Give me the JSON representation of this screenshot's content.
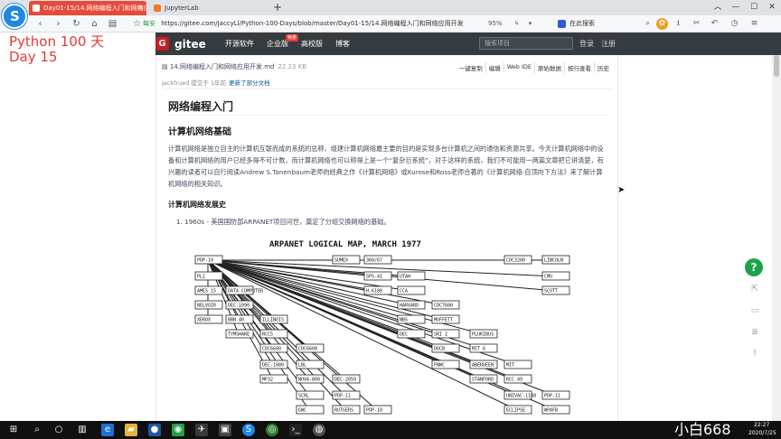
{
  "tabs": [
    {
      "title": "Day01-15/14.网络编程入门和网络应...",
      "active": true
    },
    {
      "title": "JupyterLab",
      "active": false
    }
  ],
  "new_tab": "+",
  "window_buttons": [
    "︿",
    "—",
    "☐",
    "✕"
  ],
  "address": {
    "safe_label": "每安",
    "url": "https://gitee.com/JaccyLl/Python-100-Days/blob/master/Day01-15/14.网络编程入门和网络应用开发",
    "zoom": "95%",
    "search_engine": "在此搜索"
  },
  "overlay": {
    "logo_glyph": "S",
    "title_line1": "Python 100 天",
    "title_line2": "Day 15"
  },
  "gitee": {
    "logo_letter": "G",
    "logo_text": "gitee",
    "nav": [
      "开源软件",
      "企业版",
      "高校版",
      "博客"
    ],
    "badge": "特惠",
    "search_placeholder": "搜索项目",
    "login": "登录",
    "register": "注册"
  },
  "file": {
    "name": "14.网络编程入门和网络应用开发.md",
    "size": "22.23 KB",
    "actions": [
      "一键复制",
      "编辑",
      "Web IDE",
      "原始数据",
      "按行查看",
      "历史"
    ],
    "commit_author": "jackfrued 提交于 1年前",
    "commit_msg": "更新了部分文档"
  },
  "markdown": {
    "h1": "网络编程入门",
    "h2": "计算机网络基础",
    "paragraph": "计算机网络是独立自主的计算机互联而成的系统的总称，组建计算机网络最主要的目的是实现多台计算机之间的通信和资源共享。今天计算机网络中的设备和计算机网络的用户已经多得不可计数，而计算机网络也可以称得上是一个“复杂巨系统”，对于这样的系统，我们不可能用一两篇文章把它讲清楚，有兴趣的读者可以自行阅读Andrew S.Tanenbaum老师的经典之作《计算机网络》或Kurose和Ross老师合著的《计算机网络:自顶向下方法》来了解计算机网络的相关知识。",
    "h3": "计算机网络发展史",
    "list_item": "1. 1960s - 美国国防部ARPANET项目问世，奠定了分组交换网络的基础。"
  },
  "arpanet_map": {
    "title": "ARPANET LOGICAL MAP, MARCH 1977",
    "nodes": [
      "PDP-10",
      "CDC7600",
      "CDC6600",
      "PDP-11",
      "UTAH",
      "ILLINOIS",
      "MIT",
      "PDP-10",
      "DATA COMPUTER",
      "PLURIBUS",
      "DEC-2050",
      "PL1",
      "MOFFETT",
      "LBL",
      "WPAFB",
      "CCA",
      "RCC5",
      "RCC 49",
      "360/67",
      "DEC-1090",
      "MIT 6",
      "PDP-11",
      "AMES 15",
      "SRI 2",
      "NOVA-800",
      "LINCOLN",
      "HARVARD",
      "CDC6600",
      "UNIVAC-1108",
      "SPS-41",
      "BBN 40",
      "ABERDEEN",
      "RUTGERS",
      "BELVOIR",
      "DOCB",
      "SCRL",
      "CMU",
      "NBS",
      "DEC-1080",
      "ECLIPSE",
      "H-6180",
      "TYMSHARE",
      "STANFORD",
      "SUMEX",
      "XEROX",
      "FNWC",
      "GWC",
      "SCOTT",
      "DEC",
      "MP32",
      "CDC3200"
    ],
    "footer": "PDP-10"
  },
  "floats": {
    "help": "?",
    "icons": [
      "share-icon",
      "comment-icon",
      "top-icon"
    ]
  },
  "taskbar": {
    "watermark": "小白668",
    "time": "22:27",
    "date": "2020/7/25"
  }
}
